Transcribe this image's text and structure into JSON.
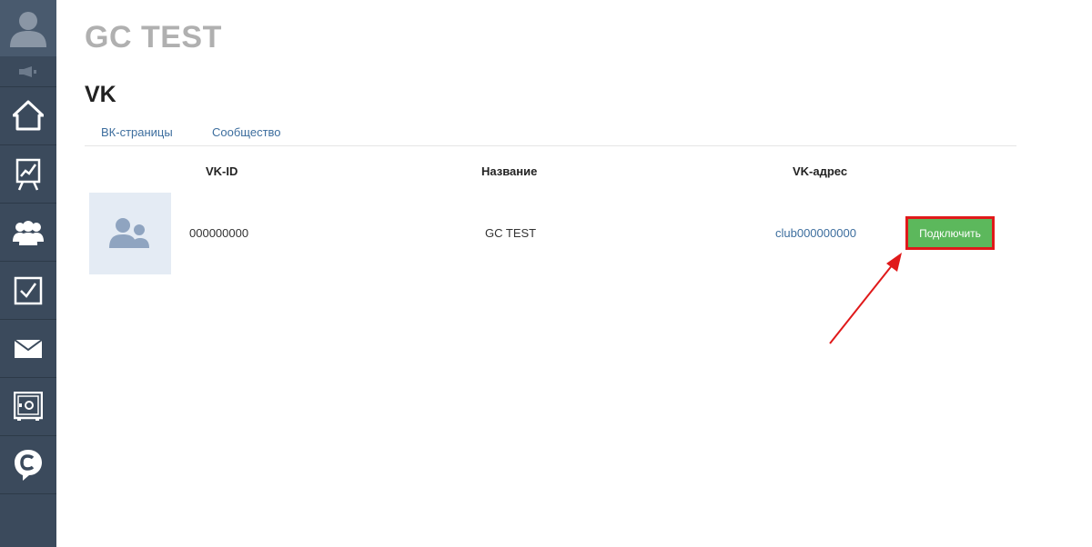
{
  "company": {
    "title": "GC TEST"
  },
  "section": {
    "title": "VK"
  },
  "tabs": [
    {
      "label": "ВК-страницы"
    },
    {
      "label": "Сообщество"
    }
  ],
  "table": {
    "headers": {
      "vk_id": "VK-ID",
      "name": "Название",
      "vk_address": "VK-адрес"
    },
    "rows": [
      {
        "vk_id": "000000000",
        "name": "GC TEST",
        "vk_address": "club000000000",
        "action_label": "Подключить"
      }
    ]
  },
  "sidebar": {
    "icons": [
      "avatar-icon",
      "mute-icon",
      "home-icon",
      "chart-icon",
      "users-icon",
      "tasks-icon",
      "mail-icon",
      "safe-icon",
      "chat-icon"
    ]
  },
  "colors": {
    "sidebar_bg": "#3b4a5c",
    "title_gray": "#b0b0b0",
    "link_blue": "#3d6e9e",
    "button_green": "#5cb85c",
    "annotation_red": "#e0191a"
  }
}
